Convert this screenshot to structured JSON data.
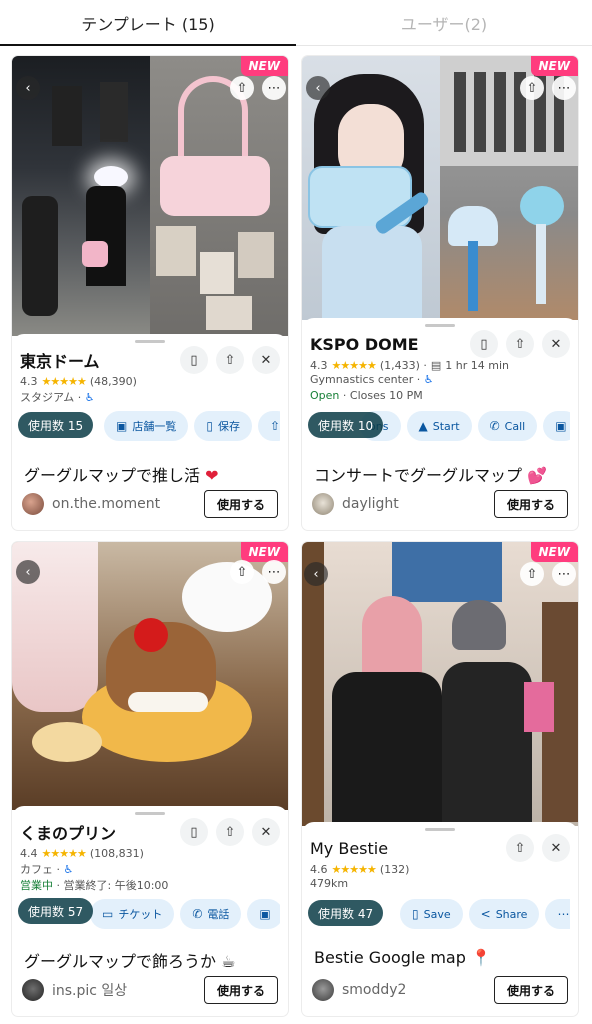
{
  "tabs": [
    {
      "label": "テンプレート (15)"
    },
    {
      "label": "ユーザー(2)"
    }
  ],
  "cards": [
    {
      "badge": "NEW",
      "place_name": "東京ドーム",
      "rating": "4.3",
      "stars": "★★★★★",
      "review_count": "(48,390)",
      "category": "スタジアム ·",
      "actions": [
        "店舗一覧",
        "保存"
      ],
      "uses_label": "使用数 15",
      "title": "グーグルマップで推し活",
      "title_emoji": "❤",
      "author": "on.the.moment",
      "use_button": "使用する"
    },
    {
      "badge": "NEW",
      "place_name": "KSPO DOME",
      "rating": "4.3",
      "stars": "★★★★★",
      "review_count": "(1,433) ·",
      "drive_time": "1 hr 14 min",
      "category": "Gymnastics center ·",
      "open_label": "Open",
      "closes": "· Closes 10 PM",
      "actions_primary_hidden": "ions",
      "actions": [
        "Start",
        "Call"
      ],
      "uses_label": "使用数 10",
      "title": "コンサートでグーグルマップ",
      "title_emoji": "💕",
      "author": "daylight",
      "use_button": "使用する"
    },
    {
      "badge": "NEW",
      "place_name": "くまのプリン",
      "rating": "4.4",
      "stars": "★★★★★",
      "review_count": "(108,831)",
      "category": "カフェ ·",
      "open_label": "営業中",
      "closes": "· 営業終了: 午後10:00",
      "actions": [
        "チケット",
        "電話"
      ],
      "uses_label": "使用数 57",
      "title": "グーグルマップで飾ろうか",
      "title_emoji": "☕",
      "author": "ins.pic 일상",
      "use_button": "使用する"
    },
    {
      "badge": "NEW",
      "place_name": "My Bestie",
      "rating": "4.6",
      "stars": "★★★★★",
      "review_count": "(132)",
      "distance": "479km",
      "actions": [
        "Save",
        "Share"
      ],
      "actions_more": "M",
      "uses_label": "使用数 47",
      "title": "Bestie Google map",
      "title_emoji": "📍",
      "author": "smoddy2",
      "use_button": "使用する"
    }
  ],
  "colors": {
    "badge": "#ff3c7e",
    "action_bg": "#e3f0fb",
    "action_text": "#0b57a0",
    "primary": "#0e6c7a",
    "stars": "#f5b400",
    "open": "#188038"
  },
  "icons": [
    "back-icon",
    "share-icon",
    "more-icon",
    "bookmark-icon",
    "close-icon",
    "store-icon",
    "phone-icon",
    "navigate-icon",
    "wheelchair-icon",
    "ticket-icon",
    "bus-icon"
  ]
}
